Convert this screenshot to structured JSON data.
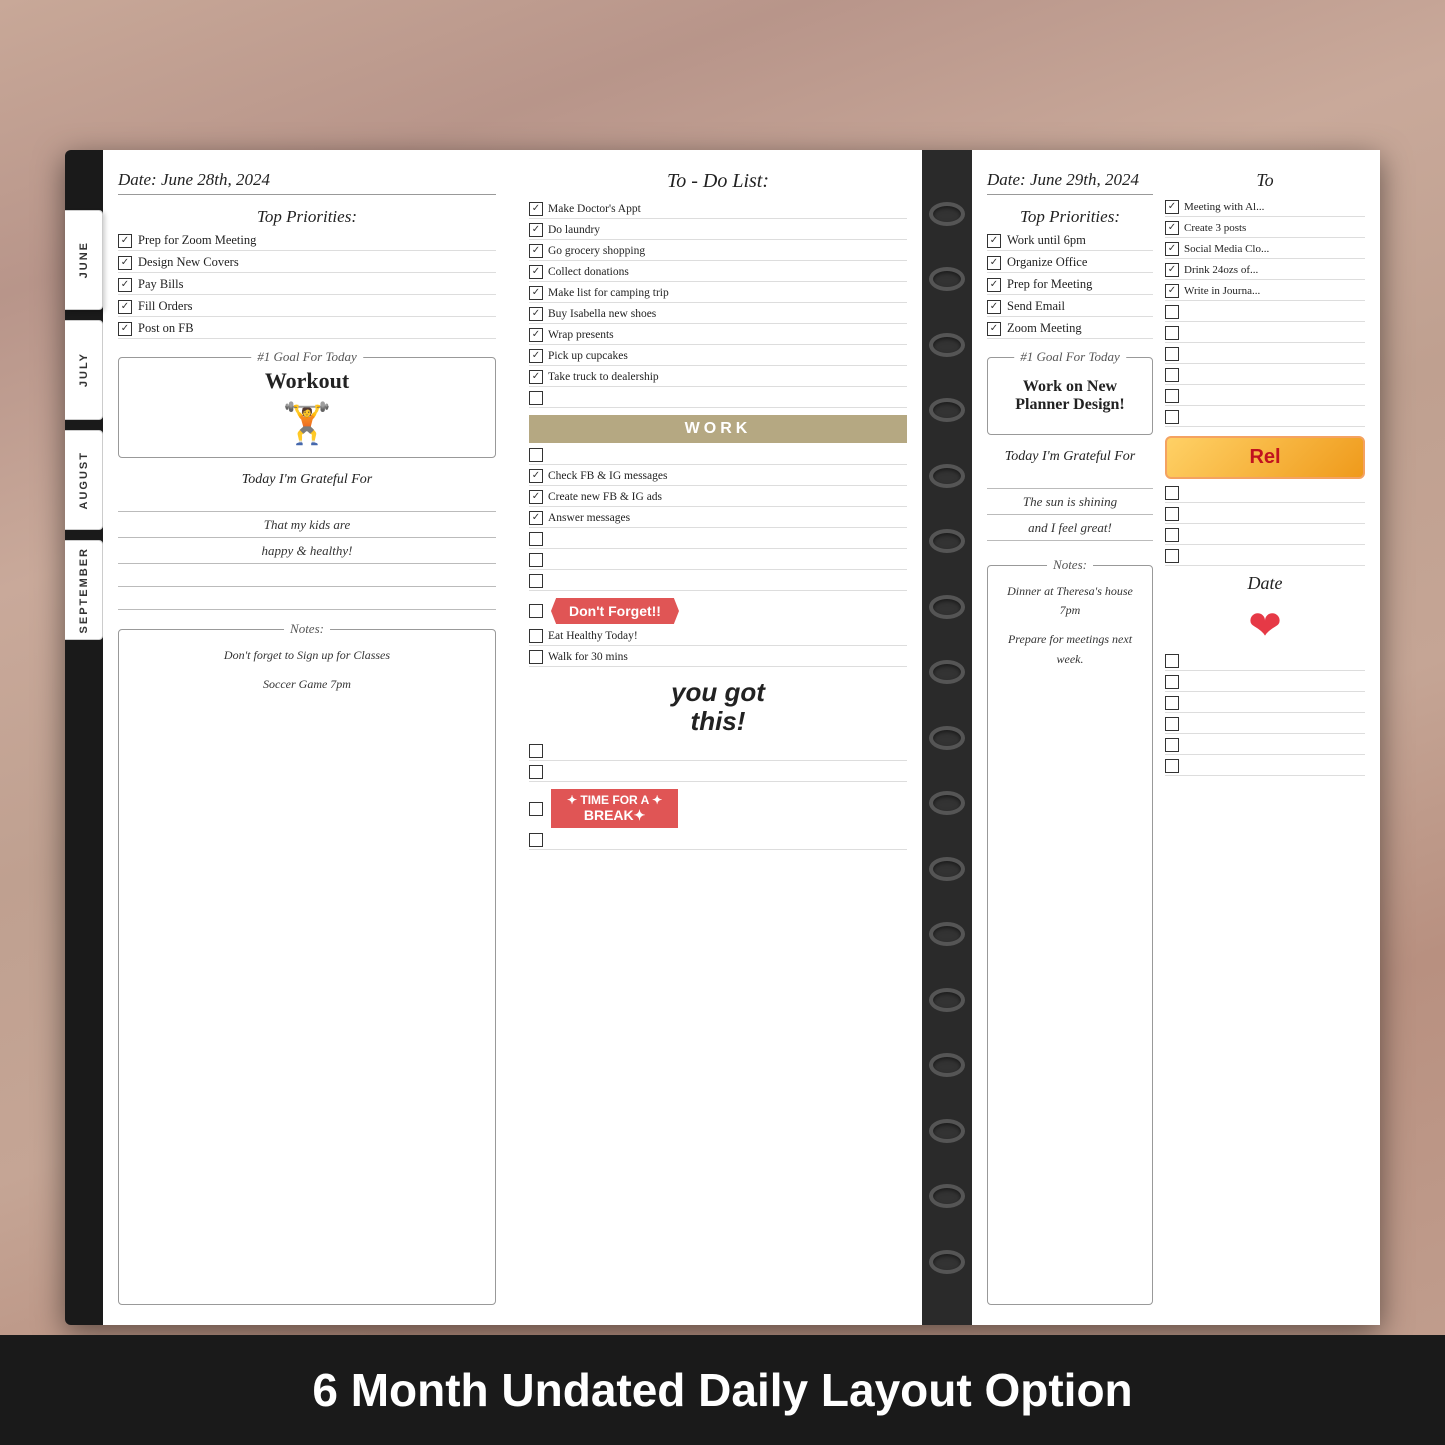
{
  "woodBg": true,
  "bottomLabel": "6 Month Undated Daily Layout Option",
  "tabs": [
    "JUNE",
    "JULY",
    "AUGUST",
    "SEPTEMBER"
  ],
  "leftPage": {
    "date": "Date: June 28th, 2024",
    "topPrioritiesTitle": "Top Priorities:",
    "priorities": [
      {
        "text": "Prep for Zoom Meeting",
        "checked": true
      },
      {
        "text": "Design New Covers",
        "checked": true
      },
      {
        "text": "Pay Bills",
        "checked": true
      },
      {
        "text": "Fill Orders",
        "checked": true
      },
      {
        "text": "Post on FB",
        "checked": true
      }
    ],
    "goalLabel": "#1 Goal For Today",
    "goalText": "Workout",
    "gratefulTitle": "Today I'm Grateful For",
    "gratefulText1": "That my kids are",
    "gratefulText2": "happy & healthy!",
    "notesLabel": "Notes:",
    "notesText1": "Don't forget to Sign up for Classes",
    "notesText2": "Soccer Game 7pm"
  },
  "todoList": {
    "title": "To - Do List:",
    "items": [
      {
        "text": "Make Doctor's Appt",
        "checked": true
      },
      {
        "text": "Do laundry",
        "checked": true
      },
      {
        "text": "Go grocery shopping",
        "checked": true
      },
      {
        "text": "Collect donations",
        "checked": true
      },
      {
        "text": "Make list for camping trip",
        "checked": true
      },
      {
        "text": "Buy Isabella new shoes",
        "checked": true
      },
      {
        "text": "Wrap presents",
        "checked": true
      },
      {
        "text": "Pick up cupcakes",
        "checked": true
      },
      {
        "text": "Take truck to dealership",
        "checked": true
      },
      {
        "text": "",
        "checked": false
      },
      {
        "text": "WORK",
        "type": "banner"
      },
      {
        "text": "",
        "checked": false
      },
      {
        "text": "Check FB & IG messages",
        "checked": true
      },
      {
        "text": "Create new FB & IG ads",
        "checked": true
      },
      {
        "text": "Answer messages",
        "checked": true
      },
      {
        "text": "",
        "checked": false
      },
      {
        "text": "",
        "checked": false
      },
      {
        "text": "",
        "checked": false
      },
      {
        "text": "dontforget",
        "type": "dontforget"
      },
      {
        "text": "",
        "checked": false
      },
      {
        "text": "Eat Healthy Today!",
        "checked": false
      },
      {
        "text": "Walk for 30 mins",
        "checked": false
      },
      {
        "text": "yougotthis",
        "type": "yougotthis"
      },
      {
        "text": "",
        "checked": false
      },
      {
        "text": "",
        "checked": false
      },
      {
        "text": "timebreak",
        "type": "timebreak"
      },
      {
        "text": "",
        "checked": false
      }
    ]
  },
  "rightPage": {
    "date": "Date: June 29th, 2024",
    "topPrioritiesTitle": "Top Priorities:",
    "priorities": [
      {
        "text": "Work until 6pm",
        "checked": true
      },
      {
        "text": "Organize Office",
        "checked": true
      },
      {
        "text": "Prep for Meeting",
        "checked": true
      },
      {
        "text": "Send Email",
        "checked": true
      },
      {
        "text": "Zoom Meeting",
        "checked": true
      }
    ],
    "goalLabel": "#1 Goal For Today",
    "goalText": "Work on New Planner Design!",
    "gratefulTitle": "Today I'm Grateful For",
    "gratefulText1": "The sun is shining",
    "gratefulText2": "and I feel great!",
    "notesLabel": "Notes:",
    "notesText1": "Dinner at Theresa's house 7pm",
    "notesText2": "Prepare for meetings next week."
  },
  "rightTodoList": {
    "title": "To",
    "items": [
      {
        "text": "Meeting with Al...",
        "checked": true
      },
      {
        "text": "Create 3 posts",
        "checked": true
      },
      {
        "text": "Social Media Clo...",
        "checked": true
      },
      {
        "text": "Drink 24ozs of...",
        "checked": true
      },
      {
        "text": "Write in Journa...",
        "checked": true
      },
      {
        "text": "",
        "checked": false
      },
      {
        "text": "",
        "checked": false
      },
      {
        "text": "",
        "checked": false
      },
      {
        "text": "",
        "checked": false
      },
      {
        "text": "",
        "checked": false
      },
      {
        "text": "",
        "checked": false
      },
      {
        "text": "",
        "checked": false
      },
      {
        "text": "",
        "checked": false
      },
      {
        "text": "",
        "checked": false
      },
      {
        "text": "",
        "checked": false
      },
      {
        "text": "relax",
        "type": "relax"
      },
      {
        "text": "",
        "checked": false
      },
      {
        "text": "",
        "checked": false
      },
      {
        "text": "",
        "checked": false
      },
      {
        "text": "",
        "checked": false
      },
      {
        "text": "Date",
        "type": "datetext"
      },
      {
        "text": "",
        "checked": false
      },
      {
        "text": "",
        "checked": false
      },
      {
        "text": "",
        "checked": false
      },
      {
        "text": "",
        "checked": false
      },
      {
        "text": "",
        "checked": false
      },
      {
        "text": "",
        "checked": false
      },
      {
        "text": "",
        "checked": false
      },
      {
        "text": "",
        "checked": false
      }
    ]
  }
}
